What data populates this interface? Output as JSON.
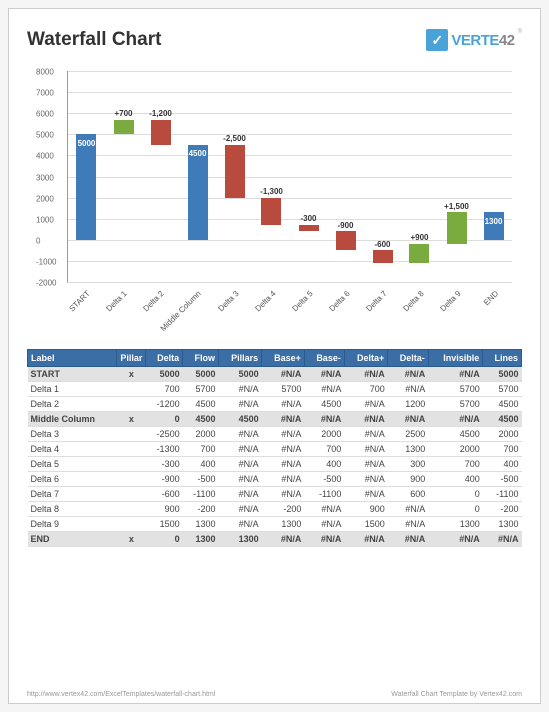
{
  "header": {
    "title": "Waterfall Chart",
    "brand": "VERTE",
    "brand_suffix": "42",
    "reg": "®",
    "mark": "✓"
  },
  "chart_data": {
    "type": "bar",
    "title": "",
    "xlabel": "",
    "ylabel": "",
    "ylim": [
      -2000,
      8000
    ],
    "yticks": [
      -2000,
      -1000,
      0,
      1000,
      2000,
      3000,
      4000,
      5000,
      6000,
      7000,
      8000
    ],
    "categories": [
      "START",
      "Delta 1",
      "Delta 2",
      "Middle Column",
      "Delta 3",
      "Delta 4",
      "Delta 5",
      "Delta 6",
      "Delta 7",
      "Delta 8",
      "Delta 9",
      "END"
    ],
    "series": [
      {
        "name": "Pillar",
        "values": [
          5000,
          null,
          null,
          4500,
          null,
          null,
          null,
          null,
          null,
          null,
          null,
          1300
        ]
      },
      {
        "name": "Delta",
        "values": [
          null,
          700,
          -1200,
          null,
          -2500,
          -1300,
          -300,
          -900,
          -600,
          900,
          1500,
          null
        ]
      }
    ],
    "cumulative": [
      5000,
      5700,
      4500,
      4500,
      2000,
      700,
      400,
      -500,
      -1100,
      -200,
      1300,
      1300
    ],
    "labels": [
      "5000",
      "+700",
      "-1,200",
      "4500",
      "-2,500",
      "-1,300",
      "-300",
      "-900",
      "-600",
      "+900",
      "+1,500",
      "1300"
    ]
  },
  "table": {
    "headers": [
      "Label",
      "Pillar",
      "Delta",
      "Flow",
      "Pillars",
      "Base+",
      "Base-",
      "Delta+",
      "Delta-",
      "Invisible",
      "Lines"
    ],
    "rows": [
      {
        "hi": true,
        "c": [
          "START",
          "x",
          "5000",
          "5000",
          "5000",
          "#N/A",
          "#N/A",
          "#N/A",
          "#N/A",
          "#N/A",
          "5000"
        ]
      },
      {
        "c": [
          "Delta 1",
          "",
          "700",
          "5700",
          "#N/A",
          "5700",
          "#N/A",
          "700",
          "#N/A",
          "5700",
          "5700"
        ]
      },
      {
        "c": [
          "Delta 2",
          "",
          "-1200",
          "4500",
          "#N/A",
          "#N/A",
          "4500",
          "#N/A",
          "1200",
          "5700",
          "4500"
        ]
      },
      {
        "hi": true,
        "c": [
          "Middle Column",
          "x",
          "0",
          "4500",
          "4500",
          "#N/A",
          "#N/A",
          "#N/A",
          "#N/A",
          "#N/A",
          "4500"
        ]
      },
      {
        "c": [
          "Delta 3",
          "",
          "-2500",
          "2000",
          "#N/A",
          "#N/A",
          "2000",
          "#N/A",
          "2500",
          "4500",
          "2000"
        ]
      },
      {
        "c": [
          "Delta 4",
          "",
          "-1300",
          "700",
          "#N/A",
          "#N/A",
          "700",
          "#N/A",
          "1300",
          "2000",
          "700"
        ]
      },
      {
        "c": [
          "Delta 5",
          "",
          "-300",
          "400",
          "#N/A",
          "#N/A",
          "400",
          "#N/A",
          "300",
          "700",
          "400"
        ]
      },
      {
        "c": [
          "Delta 6",
          "",
          "-900",
          "-500",
          "#N/A",
          "#N/A",
          "-500",
          "#N/A",
          "900",
          "400",
          "-500"
        ]
      },
      {
        "c": [
          "Delta 7",
          "",
          "-600",
          "-1100",
          "#N/A",
          "#N/A",
          "-1100",
          "#N/A",
          "600",
          "0",
          "-1100"
        ]
      },
      {
        "c": [
          "Delta 8",
          "",
          "900",
          "-200",
          "#N/A",
          "-200",
          "#N/A",
          "900",
          "#N/A",
          "0",
          "-200"
        ]
      },
      {
        "c": [
          "Delta 9",
          "",
          "1500",
          "1300",
          "#N/A",
          "1300",
          "#N/A",
          "1500",
          "#N/A",
          "1300",
          "1300"
        ]
      },
      {
        "hi": true,
        "c": [
          "END",
          "x",
          "0",
          "1300",
          "1300",
          "#N/A",
          "#N/A",
          "#N/A",
          "#N/A",
          "#N/A",
          "#N/A"
        ]
      }
    ]
  },
  "footer": {
    "url": "http://www.vertex42.com/ExcelTemplates/waterfall-chart.html",
    "credit": "Waterfall Chart Template by Vertex42.com"
  }
}
